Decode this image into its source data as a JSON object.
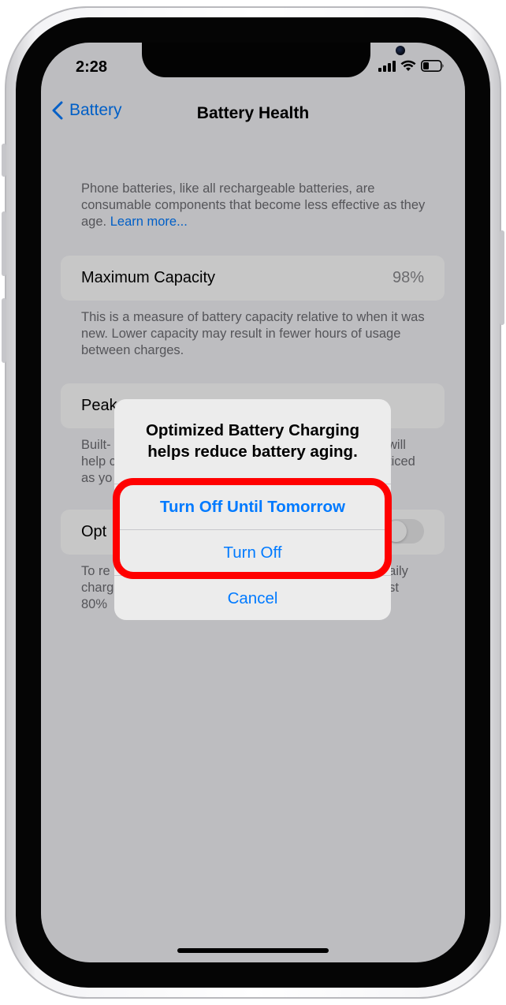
{
  "status_bar": {
    "time": "2:28",
    "icons": [
      "cellular-signal-icon",
      "wifi-icon",
      "battery-icon"
    ]
  },
  "nav": {
    "back_label": "Battery",
    "title": "Battery Health"
  },
  "intro": {
    "text": "Phone batteries, like all rechargeable batteries, are consumable components that become less effective as they age.",
    "link": "Learn more..."
  },
  "maximum_capacity": {
    "label": "Maximum Capacity",
    "value": "98%",
    "footer": "This is a measure of battery capacity relative to when it was new. Lower capacity may result in fewer hours of usage between charges."
  },
  "peak_performance": {
    "label_visible": "Peak",
    "footer_left_lines": [
      "Built-",
      "help c",
      "as yo"
    ],
    "footer_right_lines": [
      "will",
      "ticed",
      ""
    ]
  },
  "optimized_charging": {
    "label_visible": "Opt",
    "toggle_on": false,
    "footer_left_lines": [
      "To re",
      "charg",
      "80%"
    ],
    "footer_right_lines": [
      "daily",
      "ast",
      ""
    ]
  },
  "alert": {
    "title": "Optimized Battery Charging helps reduce battery aging.",
    "buttons": [
      "Turn Off Until Tomorrow",
      "Turn Off",
      "Cancel"
    ]
  },
  "colors": {
    "accent": "#007aff",
    "highlight": "#ff0000"
  }
}
